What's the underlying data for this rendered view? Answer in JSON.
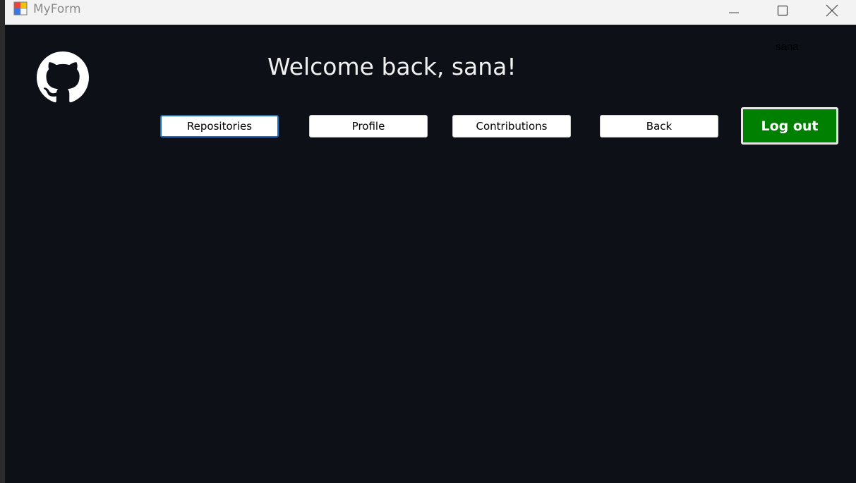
{
  "window": {
    "title": "MyForm",
    "controls": [
      "minimize",
      "maximize",
      "close"
    ]
  },
  "header": {
    "logo_icon": "github-icon",
    "welcome_text": "Welcome back, sana!",
    "username": "sana"
  },
  "nav": {
    "repositories_label": "Repositories",
    "profile_label": "Profile",
    "contributions_label": "Contributions",
    "back_label": "Back",
    "logout_label": "Log out"
  },
  "colors": {
    "background": "#0d1117",
    "logout_green": "#008000",
    "focus_border": "#1a6fc4",
    "titlebar": "#f3f3f3"
  }
}
